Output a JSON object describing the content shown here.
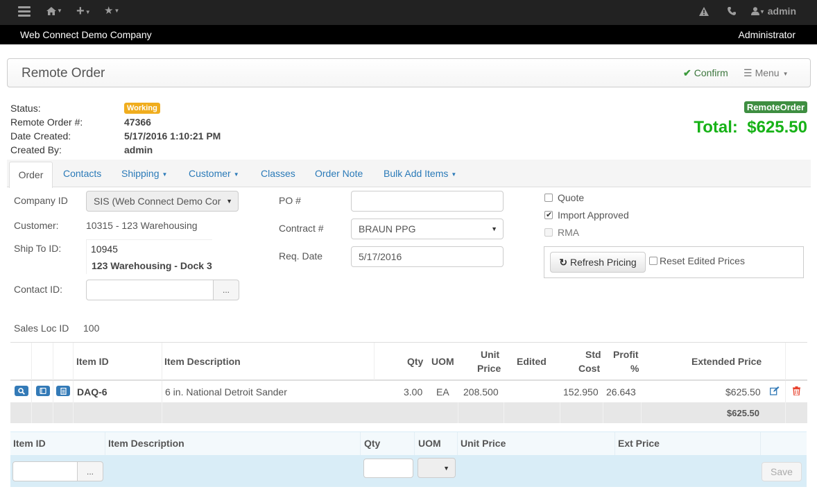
{
  "topnav": {
    "user_label": "admin"
  },
  "companybar": {
    "company_name": "Web Connect Demo Company",
    "role": "Administrator"
  },
  "header": {
    "title": "Remote Order",
    "confirm_label": "Confirm",
    "menu_label": "Menu"
  },
  "order_info": {
    "status_label": "Status:",
    "status_value": "Working",
    "order_num_label": "Remote Order #:",
    "order_num_value": "47366",
    "date_label": "Date Created:",
    "date_value": "5/17/2016 1:10:21 PM",
    "created_by_label": "Created By:",
    "created_by_value": "admin",
    "order_type_badge": "RemoteOrder",
    "total_label": "Total:",
    "total_value": "$625.50"
  },
  "tabs": [
    {
      "label": "Order"
    },
    {
      "label": "Contacts"
    },
    {
      "label": "Shipping"
    },
    {
      "label": "Customer"
    },
    {
      "label": "Classes"
    },
    {
      "label": "Order Note"
    },
    {
      "label": "Bulk Add Items"
    }
  ],
  "form": {
    "company_id_label": "Company ID",
    "company_id_value": "SIS (Web Connect Demo Cor",
    "customer_label": "Customer:",
    "customer_value": "10315 - 123 Warehousing",
    "ship_to_label": "Ship To ID:",
    "ship_to_id": "10945",
    "ship_to_name": "123 Warehousing - Dock 3",
    "contact_label": "Contact ID:",
    "contact_value": "",
    "dots": "...",
    "sales_loc_label": "Sales Loc ID",
    "sales_loc_value": "100",
    "po_label": "PO #",
    "po_value": "",
    "contract_label": "Contract #",
    "contract_value": "BRAUN PPG",
    "req_date_label": "Req. Date",
    "req_date_value": "5/17/2016",
    "quote_label": "Quote",
    "import_approved_label": "Import Approved",
    "rma_label": "RMA",
    "refresh_label": "Refresh Pricing",
    "reset_label": "Reset Edited Prices"
  },
  "line_table": {
    "headers": {
      "item_id": "Item ID",
      "item_desc": "Item Description",
      "qty": "Qty",
      "uom": "UOM",
      "unit_price_1": "Unit",
      "unit_price_2": "Price",
      "edited": "Edited",
      "std_cost_1": "Std",
      "std_cost_2": "Cost",
      "profit_1": "Profit",
      "profit_2": "%",
      "ext_price": "Extended Price"
    },
    "rows": [
      {
        "item_id": "DAQ-6",
        "description": "6 in. National Detroit Sander",
        "qty": "3.00",
        "uom": "EA",
        "unit_price": "208.500",
        "edited": "",
        "std_cost": "152.950",
        "profit": "26.643",
        "ext_price": "$625.50"
      }
    ],
    "footer_total": "$625.50"
  },
  "quick_add": {
    "headers": {
      "item_id": "Item ID",
      "item_desc": "Item Description",
      "qty": "Qty",
      "uom": "UOM",
      "unit_price": "Unit Price",
      "ext_price": "Ext Price"
    },
    "item_value": "",
    "qty_value": "",
    "dots": "...",
    "save_label": "Save"
  },
  "colors": {
    "total_green": "#17b217",
    "status_orange": "#f0ad1e",
    "link_blue": "#2a7ab8"
  }
}
